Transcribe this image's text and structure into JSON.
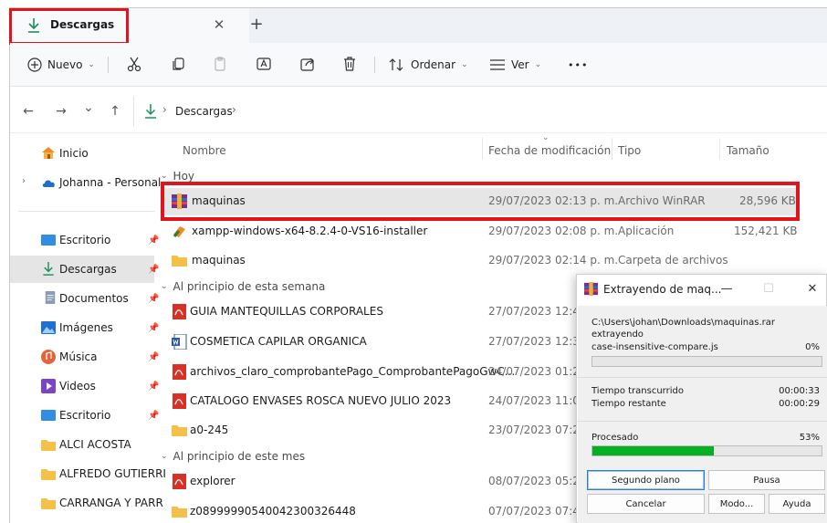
{
  "tab": {
    "title": "Descargas",
    "close": "✕",
    "new": "+"
  },
  "toolbar": {
    "new_label": "Nuevo",
    "sort_label": "Ordenar",
    "view_label": "Ver",
    "more": "•••"
  },
  "nav": {
    "back": "←",
    "forward": "→",
    "recent": "⌄",
    "up": "↑",
    "separator": "›",
    "path": "Descargas"
  },
  "sidebar": {
    "items": [
      {
        "label": "Inicio",
        "icon": "home-icon"
      },
      {
        "label": "Johanna - Personal",
        "icon": "onedrive-cloud-icon"
      },
      {
        "label": "Escritorio",
        "icon": "desktop-folder-icon",
        "pinned": true
      },
      {
        "label": "Descargas",
        "icon": "download-icon",
        "pinned": true
      },
      {
        "label": "Documentos",
        "icon": "documents-icon",
        "pinned": true
      },
      {
        "label": "Imágenes",
        "icon": "pictures-icon",
        "pinned": true
      },
      {
        "label": "Música",
        "icon": "music-icon",
        "pinned": true
      },
      {
        "label": "Videos",
        "icon": "videos-icon",
        "pinned": true
      },
      {
        "label": "Escritorio",
        "icon": "desktop-folder-icon",
        "pinned": true
      },
      {
        "label": "ALCI ACOSTA",
        "icon": "folder-icon"
      },
      {
        "label": "ALFREDO GUTIERRI",
        "icon": "folder-icon"
      },
      {
        "label": "CARRANGA Y PARR",
        "icon": "folder-icon"
      }
    ]
  },
  "columns": {
    "name": "Nombre",
    "date": "Fecha de modificación",
    "type": "Tipo",
    "size": "Tamaño"
  },
  "groups": [
    {
      "label": "Hoy",
      "rows": [
        {
          "name": "maquinas",
          "date": "29/07/2023 02:13 p. m.",
          "type": "Archivo WinRAR",
          "size": "28,596 KB",
          "icon": "winrar-icon"
        },
        {
          "name": "xampp-windows-x64-8.2.4-0-VS16-installer",
          "date": "29/07/2023 02:08 p. m.",
          "type": "Aplicación",
          "size": "152,421 KB",
          "icon": "installer-icon"
        },
        {
          "name": "maquinas",
          "date": "29/07/2023 02:14 p. m.",
          "type": "Carpeta de archivos",
          "size": "",
          "icon": "folder-icon"
        }
      ]
    },
    {
      "label": "Al principio de esta semana",
      "rows": [
        {
          "name": "GUIA MANTEQUILLAS CORPORALES",
          "date": "27/07/2023 12:43 p",
          "type": "",
          "size": "",
          "icon": "pdf-icon"
        },
        {
          "name": "COSMETICA CAPILAR ORGANICA",
          "date": "27/07/2023 12:33 p",
          "type": "",
          "size": "",
          "icon": "word-icon"
        },
        {
          "name": "archivos_claro_comprobantePago_ComprobantePagoGwC...",
          "date": "24/07/2023 01:29 p",
          "type": "",
          "size": "",
          "icon": "pdf-icon"
        },
        {
          "name": "CATALOGO ENVASES ROSCA NUEVO JULIO 2023",
          "date": "24/07/2023 11:03 a",
          "type": "",
          "size": "",
          "icon": "pdf-icon"
        },
        {
          "name": "a0-245",
          "date": "23/07/2023 07:21 p",
          "type": "",
          "size": "",
          "icon": "folder-icon"
        }
      ]
    },
    {
      "label": "Al principio de este mes",
      "rows": [
        {
          "name": "explorer",
          "date": "08/07/2023 05:26 p",
          "type": "",
          "size": "",
          "icon": "pdf-icon"
        },
        {
          "name": "z08999990540042300326448",
          "date": "07/07/2023 07:46 p",
          "type": "",
          "size": "",
          "icon": "folder-icon"
        }
      ]
    }
  ],
  "dialog": {
    "title": "Extrayendo de maq...",
    "minimize": "—",
    "maximize": "☐",
    "close": "✕",
    "archive_path": "C:\\Users\\johan\\Downloads\\maquinas.rar",
    "action": "extrayendo",
    "current_file": "case-insensitive-compare.js",
    "file_percent_label": "0%",
    "file_progress": 0,
    "elapsed_label": "Tiempo transcurrido",
    "elapsed": "00:00:33",
    "remaining_label": "Tiempo restante",
    "remaining": "00:00:29",
    "processed_label": "Procesado",
    "processed_percent_label": "53%",
    "processed_progress": 0.53,
    "buttons": {
      "background": "Segundo plano",
      "pause": "Pausa",
      "cancel": "Cancelar",
      "mode": "Modo...",
      "help": "Ayuda"
    }
  },
  "colors": {
    "highlight_red": "#e0141c",
    "progress_green": "#06b025",
    "selection_gray": "#e6e6e6"
  }
}
